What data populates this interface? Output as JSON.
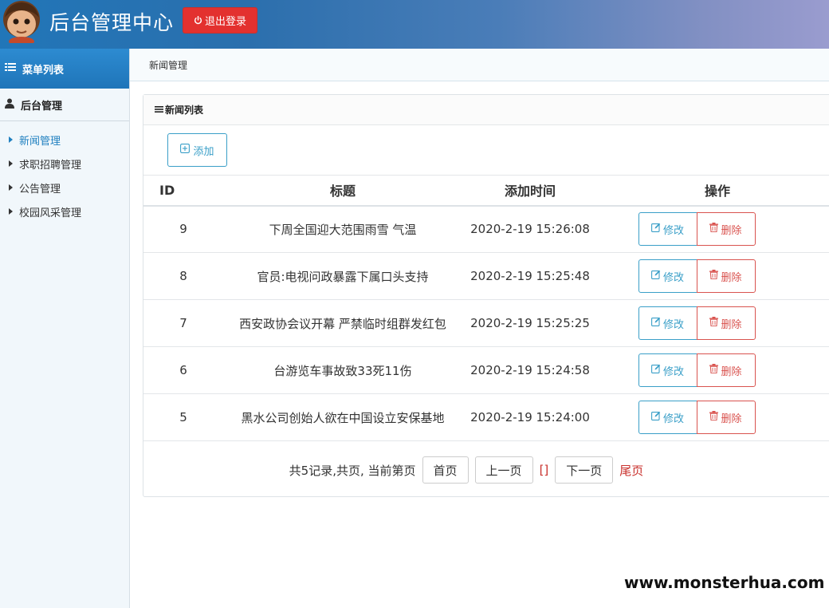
{
  "header": {
    "title": "后台管理中心",
    "logout_label": "退出登录"
  },
  "sidebar": {
    "heading": "菜单列表",
    "group_label": "后台管理",
    "items": [
      {
        "label": "新闻管理",
        "active": true
      },
      {
        "label": "求职招聘管理",
        "active": false
      },
      {
        "label": "公告管理",
        "active": false
      },
      {
        "label": "校园风采管理",
        "active": false
      }
    ]
  },
  "breadcrumb": "新闻管理",
  "panel": {
    "title": "新闻列表",
    "add_label": "添加"
  },
  "table": {
    "columns": [
      "ID",
      "标题",
      "添加时间",
      "操作"
    ],
    "edit_label": "修改",
    "delete_label": "删除",
    "rows": [
      {
        "id": "9",
        "title": "下周全国迎大范围雨雪 气温",
        "time": "2020-2-19 15:26:08"
      },
      {
        "id": "8",
        "title": "官员:电视问政暴露下属口头支持",
        "time": "2020-2-19 15:25:48"
      },
      {
        "id": "7",
        "title": "西安政协会议开幕 严禁临时组群发红包",
        "time": "2020-2-19 15:25:25"
      },
      {
        "id": "6",
        "title": "台游览车事故致33死11伤",
        "time": "2020-2-19 15:24:58"
      },
      {
        "id": "5",
        "title": "黑水公司创始人欲在中国设立安保基地",
        "time": "2020-2-19 15:24:00"
      }
    ]
  },
  "pager": {
    "summary": "共5记录,共页, 当前第页",
    "first": "首页",
    "prev": "上一页",
    "pages": "[]",
    "next": "下一页",
    "last": "尾页"
  },
  "watermark": "www.monsterhua.com",
  "colors": {
    "primary": "#2176b8",
    "danger": "#e3312f",
    "info": "#3a9fc8"
  }
}
